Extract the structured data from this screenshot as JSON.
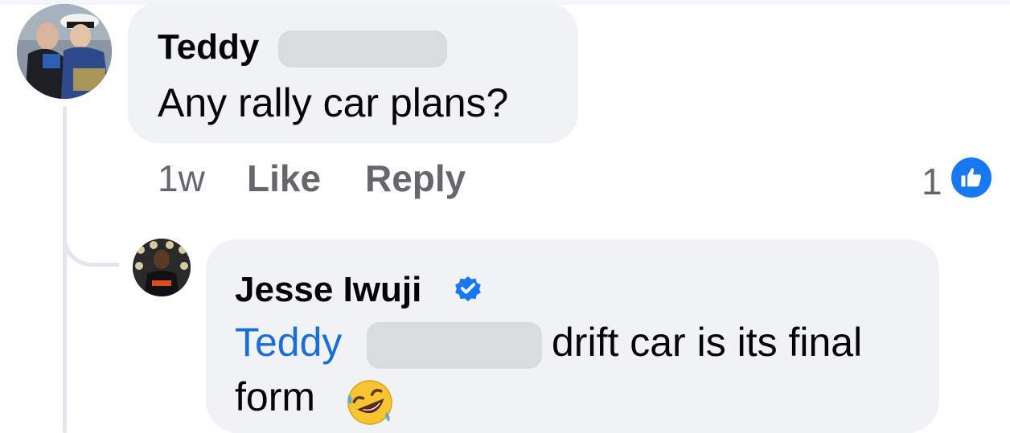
{
  "comment": {
    "author": "Teddy",
    "text": "Any rally car plans?",
    "time": "1w",
    "like_label": "Like",
    "reply_label": "Reply",
    "reaction_count": "1",
    "reaction_icon": "thumbs-up-icon"
  },
  "reply": {
    "author": "Jesse Iwuji",
    "verified_icon": "verified-badge-icon",
    "mention": "Teddy",
    "text_after_mention": "drift car is its final",
    "text_line2": "form",
    "emoji_icon": "rolling-on-floor-laughing-emoji"
  },
  "colors": {
    "bubble": "#f0f2f5",
    "meta_text": "#65676b",
    "link": "#1a6ed8",
    "like_badge": "#1877f2",
    "thread_line": "#e4e6eb"
  }
}
